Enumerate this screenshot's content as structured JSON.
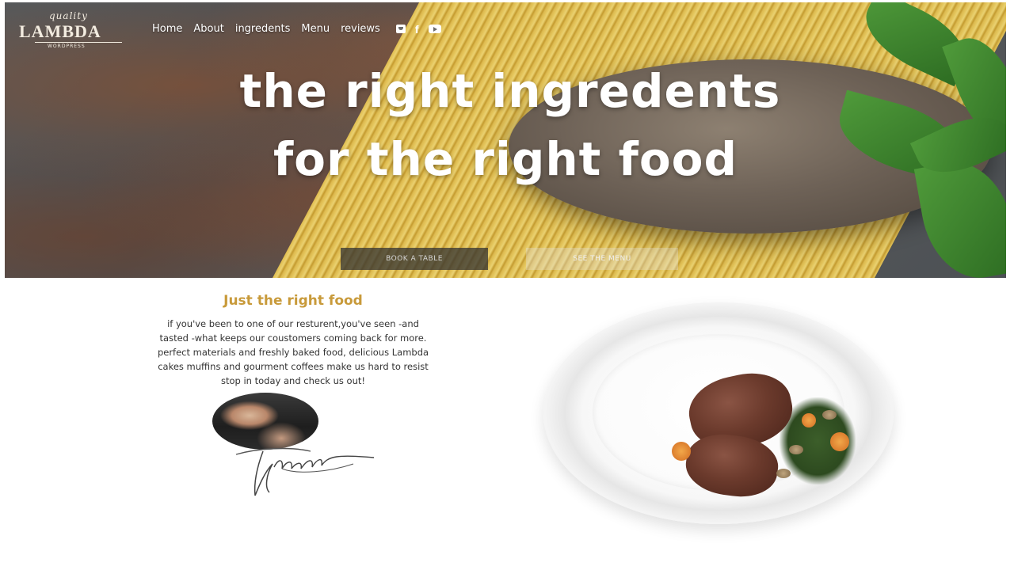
{
  "header": {
    "logo_top": "quality",
    "logo_brand": "LAMBDA",
    "logo_sub": "WORDPRESS",
    "nav": [
      {
        "label": "Home"
      },
      {
        "label": "About"
      },
      {
        "label": "ingredents"
      },
      {
        "label": "Menu"
      },
      {
        "label": "reviews"
      }
    ],
    "social_icons": [
      "twitter-icon",
      "facebook-icon",
      "youtube-icon"
    ],
    "facebook_glyph": "f"
  },
  "hero": {
    "headline_line1": "the right ingredents",
    "headline_line2": "for the right food",
    "book_button": "BOOK A TABLE",
    "menu_button": "SEE THE MENU"
  },
  "content": {
    "title": "Just the right food",
    "lines": [
      "if you've been to one of our resturent,you've seen -and",
      "tasted -what keeps our coustomers coming back for more.",
      "perfect materials and freshly baked food, delicious Lambda",
      "cakes muffins and gourment coffees make us hard to resist",
      "stop in today and check us out!"
    ]
  },
  "colors": {
    "accent": "#c89a3a",
    "text": "#333333",
    "white": "#ffffff"
  }
}
